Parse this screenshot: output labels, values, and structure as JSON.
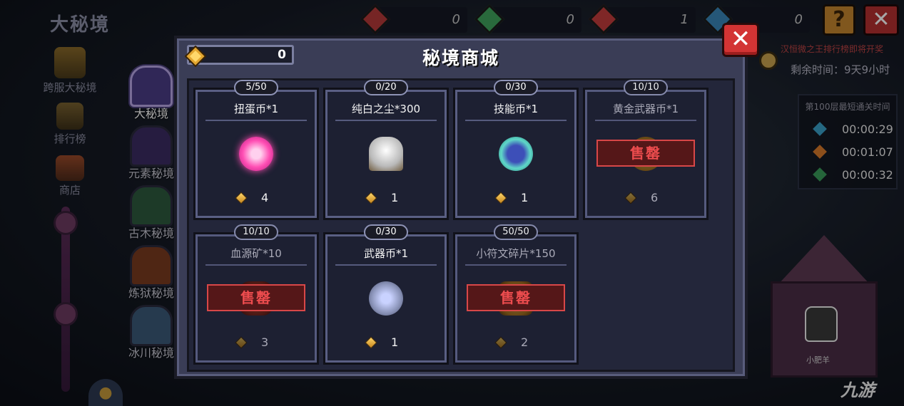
{
  "background": {
    "title": "大秘境",
    "side_nav": [
      {
        "label": "跨服大秘境",
        "icon": "trophy-icon"
      },
      {
        "label": "排行榜",
        "icon": "cup-icon"
      },
      {
        "label": "商店",
        "icon": "shop-icon"
      }
    ],
    "realm_tabs": [
      {
        "label": "大秘境",
        "active": true,
        "color": "#4a3d86"
      },
      {
        "label": "元素秘境",
        "active": false,
        "color": "#3b2c63"
      },
      {
        "label": "古木秘境",
        "active": false,
        "color": "#2d5a3e"
      },
      {
        "label": "炼狱秘境",
        "active": false,
        "color": "#7a3b20"
      },
      {
        "label": "冰川秘境",
        "active": false,
        "color": "#3b5a78"
      }
    ],
    "resources": [
      {
        "value": "0",
        "color": "#b53a3a"
      },
      {
        "value": "0",
        "color": "#3fa35c"
      },
      {
        "value": "1",
        "color": "#c43c3c"
      },
      {
        "value": "0",
        "color": "#3a86b8"
      }
    ],
    "help_label": "?",
    "close_label": "✕",
    "event_text": "汉恒微之王排行榜即将开奖",
    "time_left": "剩余时间：9天9小时",
    "record_header": "第100层最短通关时间",
    "records": [
      {
        "time": "00:00:29",
        "color": "#3aa0c8"
      },
      {
        "time": "00:01:07",
        "color": "#d87a2a"
      },
      {
        "time": "00:00:32",
        "color": "#3a9b5a"
      }
    ],
    "npc_name": "小肥羊",
    "watermark": "九游"
  },
  "shop": {
    "title": "秘境商城",
    "currency_value": "0",
    "close_label": "✕",
    "soldout_label": "售罄",
    "items": [
      {
        "limit": "5/50",
        "name": "扭蛋币*1",
        "price": "4",
        "sold_out": false,
        "icon": "gacha-coin-icon"
      },
      {
        "limit": "0/20",
        "name": "纯白之尘*300",
        "price": "1",
        "sold_out": false,
        "icon": "white-dust-icon"
      },
      {
        "limit": "0/30",
        "name": "技能币*1",
        "price": "1",
        "sold_out": false,
        "icon": "skill-coin-icon"
      },
      {
        "limit": "10/10",
        "name": "黄金武器币*1",
        "price": "6",
        "sold_out": true,
        "icon": "gold-weapon-coin-icon"
      },
      {
        "limit": "10/10",
        "name": "血源矿*10",
        "price": "3",
        "sold_out": true,
        "icon": "blood-ore-icon"
      },
      {
        "limit": "0/30",
        "name": "武器币*1",
        "price": "1",
        "sold_out": false,
        "icon": "weapon-coin-icon"
      },
      {
        "limit": "50/50",
        "name": "小符文碎片*150",
        "price": "2",
        "sold_out": true,
        "icon": "rune-shard-icon"
      }
    ]
  }
}
